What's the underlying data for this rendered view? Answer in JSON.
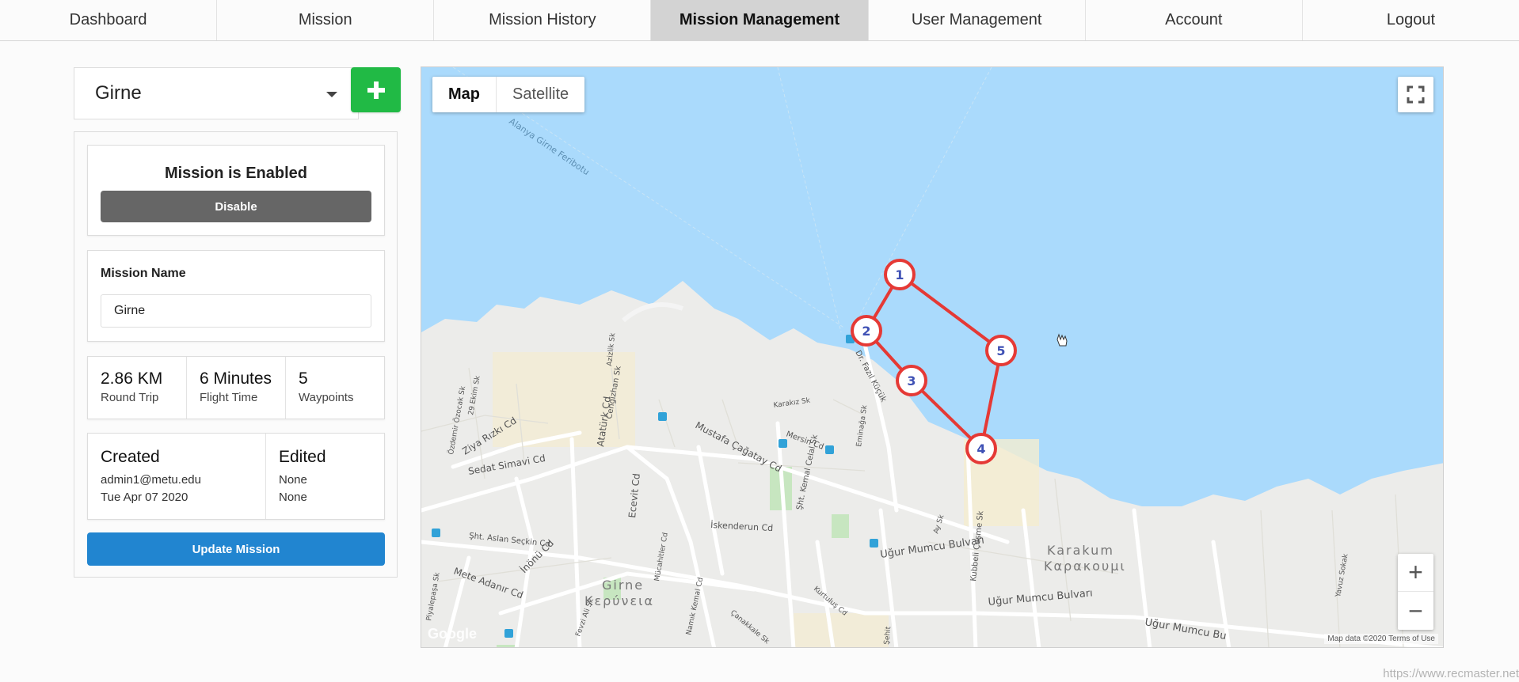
{
  "nav": {
    "items": [
      {
        "label": "Dashboard"
      },
      {
        "label": "Mission"
      },
      {
        "label": "Mission History"
      },
      {
        "label": "Mission Management",
        "active": true
      },
      {
        "label": "User Management"
      },
      {
        "label": "Account"
      },
      {
        "label": "Logout"
      }
    ]
  },
  "sidebar": {
    "selected_mission": "Girne",
    "add_icon": "plus-icon",
    "status": {
      "title": "Mission is Enabled",
      "button": "Disable"
    },
    "name": {
      "label": "Mission Name",
      "value": "Girne"
    },
    "stats": [
      {
        "value": "2.86 KM",
        "label": "Round Trip"
      },
      {
        "value": "6 Minutes",
        "label": "Flight Time"
      },
      {
        "value": "5",
        "label": "Waypoints"
      }
    ],
    "created": {
      "title": "Created",
      "by": "admin1@metu.edu",
      "date": "Tue Apr 07 2020"
    },
    "edited": {
      "title": "Edited",
      "by": "None",
      "date": "None"
    },
    "update_button": "Update Mission"
  },
  "map": {
    "type_map": "Map",
    "type_satellite": "Satellite",
    "zoom_in": "+",
    "zoom_out": "−",
    "google": "Google",
    "attribution": "Map data ©2020  Terms of Use",
    "watermark": "https://www.recmaster.net",
    "route_color": "#e53935",
    "waypoints": [
      "1",
      "2",
      "3",
      "4",
      "5"
    ],
    "labels": {
      "ferry": "Alanya Girne Feribotu",
      "karakum_1": "Karakum",
      "karakum_2": "Καρακουμι",
      "girne_1": "Girne",
      "girne_2": "Κερύνεια",
      "ugur_1": "Uğur Mumcu Bulvarı",
      "ugur_2": "Uğur Mumcu Bulvarı",
      "ugur_3": "Uğur Mumcu Bu",
      "mustafa": "Mustafa Çağatay Cd",
      "ziya": "Ziya Rızkı Cd",
      "sedat": "Sedat Simavi Cd",
      "ataturk": "Atatürk Cd",
      "ecevit": "Ecevit Cd",
      "iskenderun": "İskenderun Cd",
      "inonu": "İnönü Cd",
      "mete": "Mete Adanır Cd",
      "mersin": "Mersin Cd",
      "kubbeli": "Kubbeli Çeşme Sk",
      "aslan": "Şht. Aslan Seçkin Cd",
      "kemal": "Şht. Kemal Celal Sk",
      "fazil": "Dr. Fazıl Küçük",
      "cengizhan": "Cengizhan Sk",
      "karakiz": "Karakız Sk",
      "emin": "Eminağa Sk",
      "kurtulus": "Kurtuluş Cd",
      "namik": "Namık Kemal Cd",
      "canakkale": "Çanakkale Sk",
      "mucahitler": "Mücahitler Cd",
      "sehit": "Şehit",
      "piyale": "Piyalepaşa Sk",
      "fevzi": "Fevzi Ali Sk",
      "ozdemir": "Özdemir Özocak Sk",
      "ekim": "29 Ekim Sk",
      "ay": "Ay Sk",
      "aziz": "Azizlik Sk",
      "yavuz": "Yavuz Sokak"
    }
  }
}
